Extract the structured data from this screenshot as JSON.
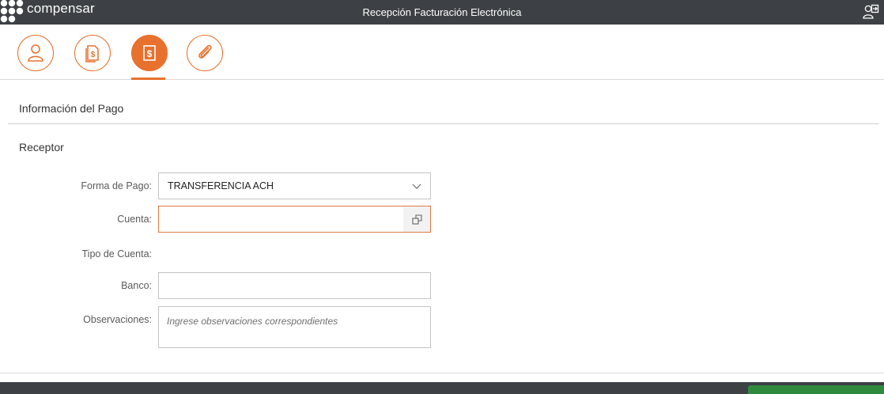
{
  "header": {
    "brand": "compensar",
    "title": "Recepción Facturación Electrónica",
    "user_icon": "user-logout-icon",
    "background": "#3d4044"
  },
  "steps": [
    {
      "icon": "user-icon",
      "active": false
    },
    {
      "icon": "invoice-dollar-icon",
      "active": false
    },
    {
      "icon": "payment-dollar-icon",
      "active": true
    },
    {
      "icon": "paperclip-icon",
      "active": false
    }
  ],
  "accent_color": "#e8712e",
  "section": {
    "title": "Información del Pago",
    "subtitle": "Receptor"
  },
  "form": {
    "forma_pago": {
      "label": "Forma de Pago:",
      "value": "TRANSFERENCIA ACH"
    },
    "cuenta": {
      "label": "Cuenta:",
      "value": ""
    },
    "tipo_cuenta": {
      "label": "Tipo de Cuenta:",
      "value": ""
    },
    "banco": {
      "label": "Banco:",
      "value": ""
    },
    "observaciones": {
      "label": "Observaciones:",
      "placeholder": "Ingrese observaciones correspondientes"
    }
  },
  "footer": {
    "button_color": "#2f8a3e"
  }
}
